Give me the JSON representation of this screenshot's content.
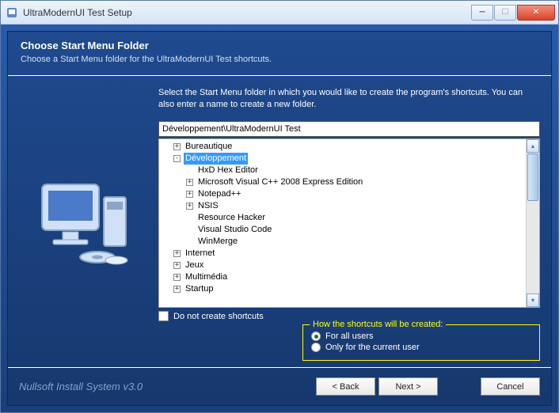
{
  "window": {
    "title": "UltraModernUI Test Setup"
  },
  "header": {
    "title": "Choose Start Menu Folder",
    "subtitle": "Choose a Start Menu folder for the UltraModernUI Test shortcuts."
  },
  "instruction": "Select the Start Menu folder in which you would like to create the program's shortcuts. You can also enter a name to create a new folder.",
  "path_value": "Développement\\UltraModernUI Test",
  "tree": [
    {
      "label": "Bureautique",
      "indent": 1,
      "exp": "+"
    },
    {
      "label": "Développement",
      "indent": 1,
      "exp": "-",
      "selected": true
    },
    {
      "label": "HxD Hex Editor",
      "indent": 2,
      "exp": ""
    },
    {
      "label": "Microsoft Visual C++ 2008 Express Edition",
      "indent": 2,
      "exp": "+"
    },
    {
      "label": "Notepad++",
      "indent": 2,
      "exp": "+"
    },
    {
      "label": "NSIS",
      "indent": 2,
      "exp": "+"
    },
    {
      "label": "Resource Hacker",
      "indent": 2,
      "exp": ""
    },
    {
      "label": "Visual Studio Code",
      "indent": 2,
      "exp": ""
    },
    {
      "label": "WinMerge",
      "indent": 2,
      "exp": ""
    },
    {
      "label": "Internet",
      "indent": 1,
      "exp": "+"
    },
    {
      "label": "Jeux",
      "indent": 1,
      "exp": "+"
    },
    {
      "label": "Multimédia",
      "indent": 1,
      "exp": "+"
    },
    {
      "label": "Startup",
      "indent": 1,
      "exp": "+"
    }
  ],
  "checkbox": {
    "label": "Do not create shortcuts",
    "checked": false
  },
  "group": {
    "legend": "How the shortcuts will be created:",
    "options": [
      {
        "label": "For all users",
        "checked": true
      },
      {
        "label": "Only for the current user",
        "checked": false
      }
    ]
  },
  "footer": {
    "brand": "Nullsoft Install System v3.0",
    "back": "< Back",
    "next": "Next >",
    "cancel": "Cancel"
  }
}
